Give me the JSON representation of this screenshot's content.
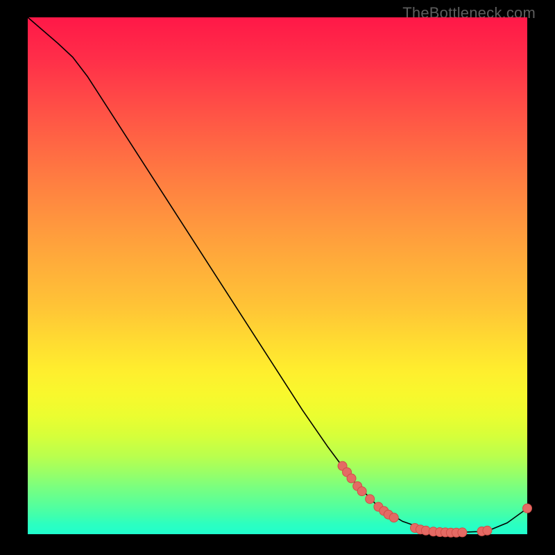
{
  "watermark": "TheBottleneck.com",
  "colors": {
    "curve": "#000000",
    "point_fill": "#e46a64",
    "point_stroke": "#cf4e48",
    "background": "#000000"
  },
  "chart_data": {
    "type": "line",
    "title": "",
    "xlabel": "",
    "ylabel": "",
    "xlim": [
      0,
      100
    ],
    "ylim": [
      0,
      100
    ],
    "curve": [
      {
        "x": 0.0,
        "y": 100.0
      },
      {
        "x": 3.0,
        "y": 97.5
      },
      {
        "x": 6.0,
        "y": 95.0
      },
      {
        "x": 9.0,
        "y": 92.3
      },
      {
        "x": 12.0,
        "y": 88.5
      },
      {
        "x": 15.0,
        "y": 84.0
      },
      {
        "x": 20.0,
        "y": 76.5
      },
      {
        "x": 25.0,
        "y": 69.0
      },
      {
        "x": 30.0,
        "y": 61.5
      },
      {
        "x": 35.0,
        "y": 54.0
      },
      {
        "x": 40.0,
        "y": 46.5
      },
      {
        "x": 45.0,
        "y": 39.0
      },
      {
        "x": 50.0,
        "y": 31.5
      },
      {
        "x": 55.0,
        "y": 24.0
      },
      {
        "x": 60.0,
        "y": 17.0
      },
      {
        "x": 65.0,
        "y": 10.5
      },
      {
        "x": 70.0,
        "y": 5.5
      },
      {
        "x": 75.0,
        "y": 2.5
      },
      {
        "x": 80.0,
        "y": 0.8
      },
      {
        "x": 85.0,
        "y": 0.3
      },
      {
        "x": 90.0,
        "y": 0.5
      },
      {
        "x": 93.0,
        "y": 1.0
      },
      {
        "x": 96.0,
        "y": 2.2
      },
      {
        "x": 100.0,
        "y": 5.0
      }
    ],
    "points": [
      {
        "x": 63.0,
        "y": 13.2
      },
      {
        "x": 63.9,
        "y": 12.0
      },
      {
        "x": 64.8,
        "y": 10.8
      },
      {
        "x": 66.0,
        "y": 9.3
      },
      {
        "x": 66.9,
        "y": 8.3
      },
      {
        "x": 68.5,
        "y": 6.8
      },
      {
        "x": 70.2,
        "y": 5.3
      },
      {
        "x": 71.3,
        "y": 4.5
      },
      {
        "x": 72.2,
        "y": 3.8
      },
      {
        "x": 73.3,
        "y": 3.2
      },
      {
        "x": 77.5,
        "y": 1.2
      },
      {
        "x": 78.6,
        "y": 0.9
      },
      {
        "x": 79.7,
        "y": 0.7
      },
      {
        "x": 81.2,
        "y": 0.5
      },
      {
        "x": 82.5,
        "y": 0.4
      },
      {
        "x": 83.6,
        "y": 0.35
      },
      {
        "x": 84.7,
        "y": 0.3
      },
      {
        "x": 85.8,
        "y": 0.3
      },
      {
        "x": 87.0,
        "y": 0.35
      },
      {
        "x": 90.9,
        "y": 0.55
      },
      {
        "x": 92.0,
        "y": 0.7
      },
      {
        "x": 100.0,
        "y": 5.0
      }
    ]
  }
}
